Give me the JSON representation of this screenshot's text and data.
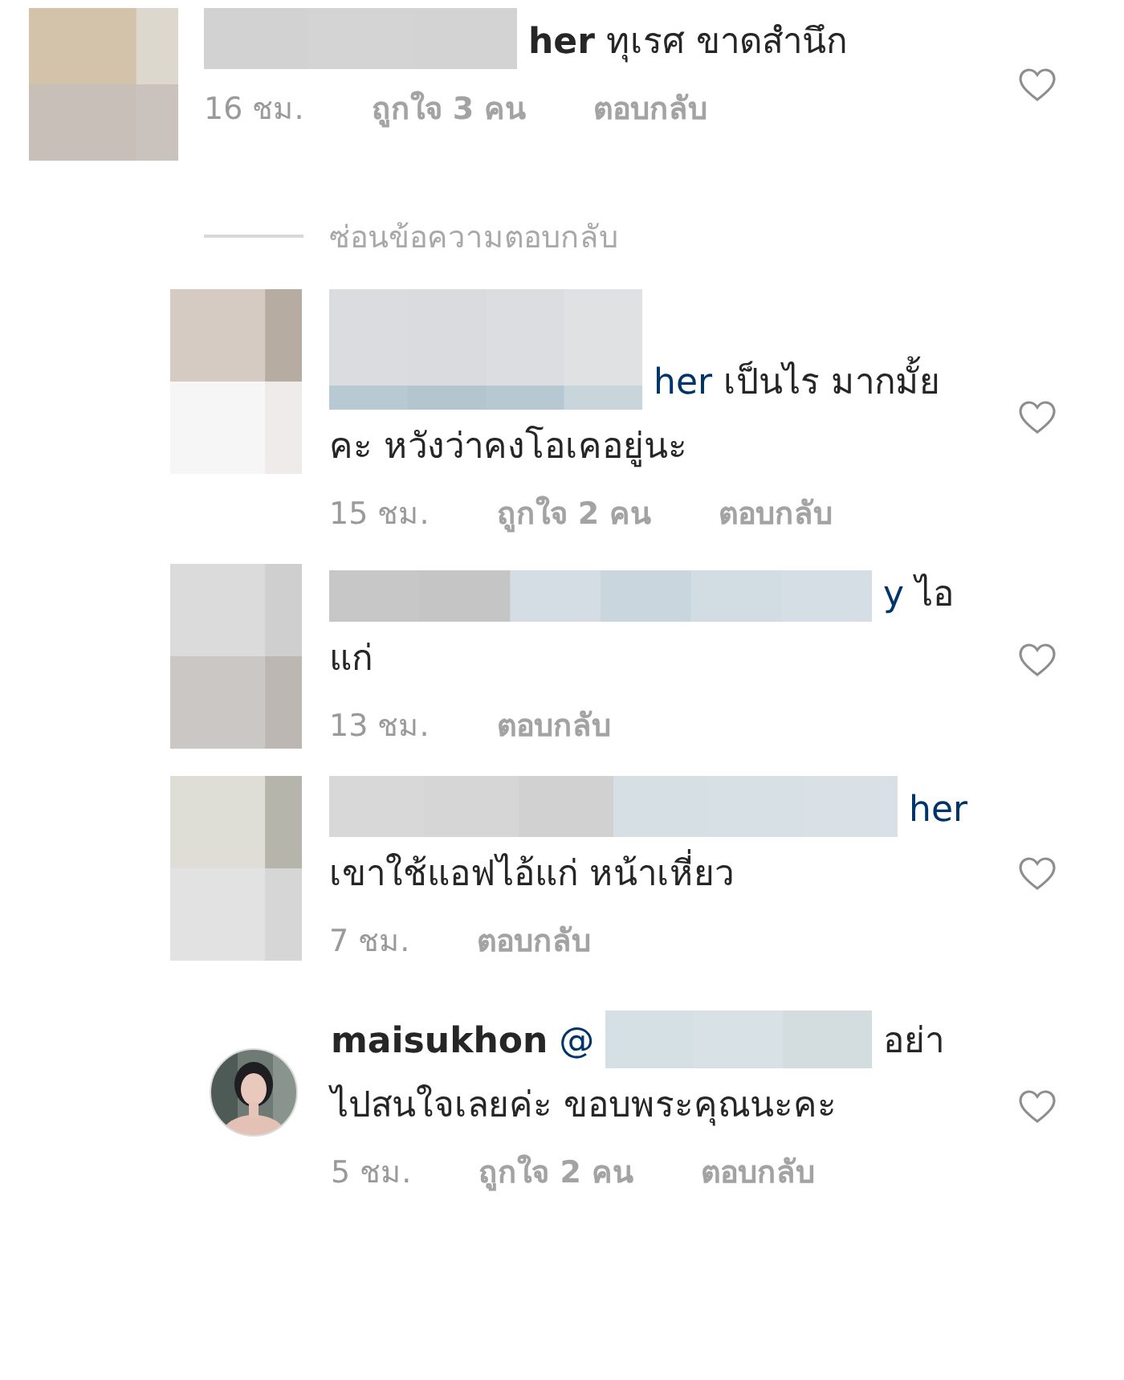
{
  "comments": [
    {
      "avatar": {
        "kind": "mosaic"
      },
      "line_1": [
        {
          "kind": "censored"
        },
        {
          "kind": "name",
          "text": "her"
        },
        {
          "kind": "text",
          "text": "ทุเรศ ขาดสำนึก"
        }
      ],
      "time": "16 ชม.",
      "likes": "ถูกใจ 3 คน",
      "reply": "ตอบกลับ",
      "liked": false,
      "hide_replies": "ซ่อนข้อความตอบกลับ",
      "replies": [
        {
          "avatar": {
            "kind": "mosaic"
          },
          "line_1": [
            {
              "kind": "censored"
            },
            {
              "kind": "mention",
              "text": "her"
            },
            {
              "kind": "text",
              "text": "เป็นไร มากมั้ย"
            }
          ],
          "line_2": "คะ หวังว่าคงโอเคอยู่นะ",
          "time": "15 ชม.",
          "likes": "ถูกใจ 2 คน",
          "reply": "ตอบกลับ",
          "liked": false
        },
        {
          "avatar": {
            "kind": "mosaic"
          },
          "line_1": [
            {
              "kind": "censored"
            },
            {
              "kind": "mention",
              "text": "y"
            },
            {
              "kind": "text",
              "text": "ไอ"
            }
          ],
          "line_2": "แก่",
          "time": "13 ชม.",
          "reply": "ตอบกลับ",
          "liked": false
        },
        {
          "avatar": {
            "kind": "mosaic"
          },
          "line_1": [
            {
              "kind": "censored"
            },
            {
              "kind": "mention",
              "text": "her"
            }
          ],
          "line_2": "เขาใช้แอฟไอ้แก่ หน้าเหี่ยว",
          "time": "7 ชม.",
          "reply": "ตอบกลับ",
          "liked": false
        },
        {
          "line_1": [
            {
              "kind": "name",
              "text": "maisukhon"
            },
            {
              "kind": "mention",
              "text": "@"
            },
            {
              "kind": "censored"
            },
            {
              "kind": "text",
              "text": "อย่า"
            }
          ],
          "line_2": "ไปสนใจเลยค่ะ ขอบพระคุณนะคะ",
          "time": "5 ชม.",
          "likes": "ถูกใจ 2 คน",
          "reply": "ตอบกลับ",
          "liked": false
        }
      ]
    }
  ]
}
